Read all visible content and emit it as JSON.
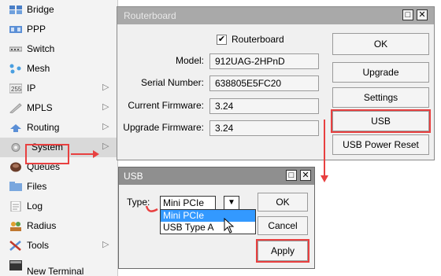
{
  "menu": {
    "items": [
      {
        "label": "Bridge",
        "icon": "bridge-icon"
      },
      {
        "label": "PPP",
        "icon": "ppp-icon"
      },
      {
        "label": "Switch",
        "icon": "switch-icon"
      },
      {
        "label": "Mesh",
        "icon": "mesh-icon"
      },
      {
        "label": "IP",
        "icon": "ip-icon",
        "submenu": true
      },
      {
        "label": "MPLS",
        "icon": "mpls-icon",
        "submenu": true
      },
      {
        "label": "Routing",
        "icon": "routing-icon",
        "submenu": true
      },
      {
        "label": "System",
        "icon": "system-icon",
        "submenu": true,
        "highlighted": true
      },
      {
        "label": "Queues",
        "icon": "queues-icon"
      },
      {
        "label": "Files",
        "icon": "files-icon"
      },
      {
        "label": "Log",
        "icon": "log-icon"
      },
      {
        "label": "Radius",
        "icon": "radius-icon"
      },
      {
        "label": "Tools",
        "icon": "tools-icon",
        "submenu": true
      },
      {
        "label": "New Terminal",
        "icon": "terminal-icon"
      }
    ]
  },
  "routerboard_window": {
    "title": "Routerboard",
    "checkbox_label": "Routerboard",
    "checked": true,
    "model_label": "Model:",
    "model_value": "912UAG-2HPnD",
    "serial_label": "Serial Number:",
    "serial_value": "638805E5FC20",
    "current_fw_label": "Current Firmware:",
    "current_fw_value": "3.24",
    "upgrade_fw_label": "Upgrade Firmware:",
    "upgrade_fw_value": "3.24",
    "buttons": {
      "ok": "OK",
      "upgrade": "Upgrade",
      "settings": "Settings",
      "usb": "USB",
      "usb_power_reset": "USB Power Reset"
    }
  },
  "usb_dialog": {
    "title": "USB",
    "type_label": "Type:",
    "type_value": "Mini PCIe",
    "options": [
      "Mini PCIe",
      "USB Type A"
    ],
    "highlighted_option": "Mini PCIe",
    "buttons": {
      "ok": "OK",
      "cancel": "Cancel",
      "apply": "Apply"
    }
  },
  "colors": {
    "annotation_red": "#e84040",
    "selected_option": "#3399ff",
    "title_bar": "#a9a9a9"
  }
}
